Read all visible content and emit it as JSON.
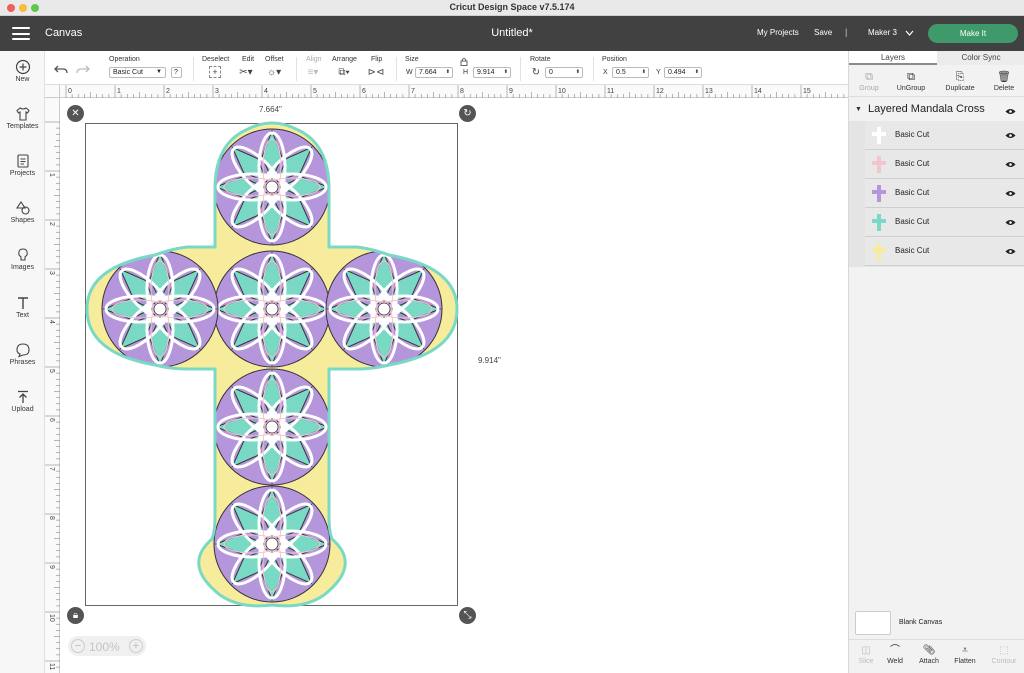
{
  "window": {
    "title": "Cricut Design Space  v7.5.174"
  },
  "header": {
    "section": "Canvas",
    "document_title": "Untitled*",
    "my_projects": "My Projects",
    "save": "Save",
    "separator": "|",
    "machine": "Maker 3",
    "make_it": "Make It"
  },
  "colors": {
    "header_bg": "#414141",
    "make_it": "#3f9a6b",
    "purple": "#b596dd",
    "teal": "#7ad9c4",
    "yellow": "#f7ec9c",
    "pink": "#f2c6cf",
    "white": "#ffffff"
  },
  "toolbar": {
    "operation_label": "Operation",
    "operation_value": "Basic Cut",
    "help": "?",
    "deselect": "Deselect",
    "edit": "Edit",
    "offset": "Offset",
    "align": "Align",
    "arrange": "Arrange",
    "flip": "Flip",
    "size_label": "Size",
    "w_label": "W",
    "w_value": "7.664",
    "h_label": "H",
    "h_value": "9.914",
    "rotate_label": "Rotate",
    "rotate_value": "0",
    "position_label": "Position",
    "x_label": "X",
    "x_value": "0.5",
    "y_label": "Y",
    "y_value": "0.494"
  },
  "leftbar": {
    "new": "New",
    "templates": "Templates",
    "projects": "Projects",
    "shapes": "Shapes",
    "images": "Images",
    "text": "Text",
    "phrases": "Phrases",
    "upload": "Upload"
  },
  "ruler": {
    "h": [
      "0",
      "1",
      "2",
      "3",
      "4",
      "5",
      "6",
      "7",
      "8",
      "9",
      "10",
      "11",
      "12",
      "13",
      "14",
      "15",
      "16"
    ],
    "v": [
      "1",
      "2",
      "3",
      "4",
      "5",
      "6",
      "7",
      "8",
      "9",
      "10",
      "11"
    ]
  },
  "canvas": {
    "width_label": "7.664\"",
    "height_label": "9.914\"",
    "zoom_minus": "−",
    "zoom": "100%",
    "zoom_plus": "+"
  },
  "panel": {
    "tab_layers": "Layers",
    "tab_color_sync": "Color Sync",
    "group": "Group",
    "ungroup": "UnGroup",
    "duplicate": "Duplicate",
    "delete": "Delete",
    "group_name": "Layered Mandala Cross",
    "layers": [
      {
        "name": "Basic Cut",
        "color": "#ffffff"
      },
      {
        "name": "Basic Cut",
        "color": "#f2c6cf"
      },
      {
        "name": "Basic Cut",
        "color": "#b596dd"
      },
      {
        "name": "Basic Cut",
        "color": "#7ad9c4"
      },
      {
        "name": "Basic Cut",
        "color": "#f7ec9c"
      }
    ],
    "blank_canvas": "Blank Canvas",
    "slice": "Slice",
    "weld": "Weld",
    "attach": "Attach",
    "flatten": "Flatten",
    "contour": "Contour"
  }
}
